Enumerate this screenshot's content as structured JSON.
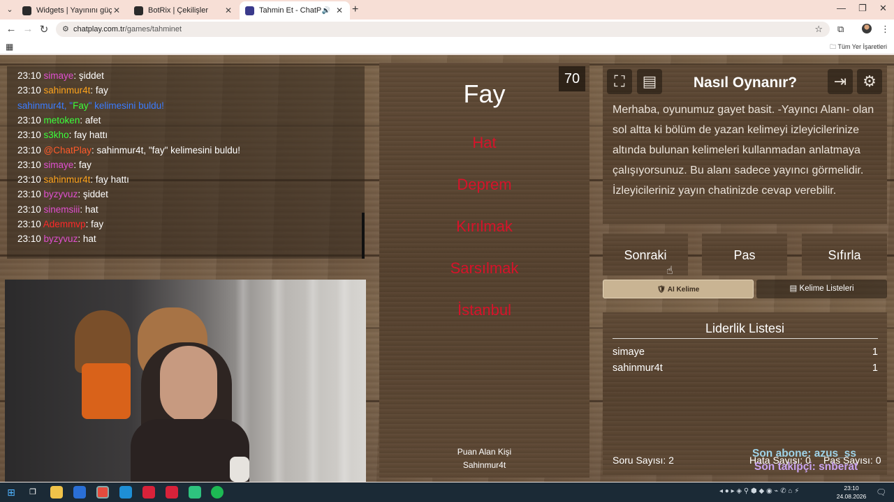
{
  "browser": {
    "tabs": [
      {
        "title": "Widgets | Yayınını güçlendirmek",
        "favicon_color": "#2b2b2b"
      },
      {
        "title": "BotRix | Çekilişler",
        "favicon_color": "#2b2b2b"
      },
      {
        "title": "Tahmin Et - ChatPlay",
        "favicon_color": "#3a3a8c"
      }
    ],
    "url_host": "chatplay.com.tr",
    "url_path": "/games/tahminet",
    "bookmarks_all": "Tüm Yer İşaretleri"
  },
  "chat": {
    "lines": [
      {
        "time": "23:10",
        "user": "simaye",
        "color": "#e04fd0",
        "msg": ": şiddet"
      },
      {
        "time": "23:10",
        "user": "sahinmur4t",
        "color": "#ffa41c",
        "msg": ": fay"
      },
      {
        "time": "",
        "user": "sahinmur4t, \"",
        "color": "#3b7cff",
        "msg": "",
        "special": "found",
        "word": "Fay",
        "rest": "\" kelimesini buldu!"
      },
      {
        "time": "23:10",
        "user": "metoken",
        "color": "#3bff3b",
        "msg": ": afet"
      },
      {
        "time": "23:10",
        "user": "s3kho",
        "color": "#3bff3b",
        "msg": ": fay hattı"
      },
      {
        "time": "23:10",
        "user": "@ChatPlay",
        "color": "#ff5a2a",
        "msg": ": sahinmur4t, \"fay\" kelimesini buldu!"
      },
      {
        "time": "23:10",
        "user": "simaye",
        "color": "#e04fd0",
        "msg": ": fay"
      },
      {
        "time": "23:10",
        "user": "sahinmur4t",
        "color": "#ffa41c",
        "msg": ": fay hattı"
      },
      {
        "time": "23:10",
        "user": "byzyvuz",
        "color": "#e04fd0",
        "msg": ": şiddet"
      },
      {
        "time": "23:10",
        "user": "sinemsiii",
        "color": "#e04fd0",
        "msg": ": hat"
      },
      {
        "time": "23:10",
        "user": "Ademmvp",
        "color": "#ff2a2a",
        "msg": ": fay"
      },
      {
        "time": "23:10",
        "user": "byzyvuz",
        "color": "#e04fd0",
        "msg": ": hat"
      }
    ]
  },
  "card": {
    "score": "70",
    "word": "Fay",
    "taboo": [
      "Hat",
      "Deprem",
      "Kırılmak",
      "Sarsılmak",
      "İstanbul"
    ],
    "scorer_label": "Puan Alan Kişi",
    "scorer_name": "Sahinmur4t"
  },
  "howto": {
    "title": "Nasıl Oynanır?",
    "text": "Merhaba, oyunumuz gayet basit. -Yayıncı Alanı- olan sol altta ki bölüm de yazan kelimeyi izleyicilerinize altında bulunan kelimeleri kullanmadan anlatmaya çalışıyorsunuz. Bu alanı sadece yayıncı görmelidir. İzleyicileriniz yayın chatinizde cevap verebilir."
  },
  "controls": {
    "next": "Sonraki",
    "pass": "Pas",
    "reset": "Sıfırla",
    "ai_word": "🛡 AI Kelime",
    "word_lists": "Kelime Listeleri"
  },
  "leaderboard": {
    "title": "Liderlik Listesi",
    "rows": [
      {
        "name": "simaye",
        "points": "1"
      },
      {
        "name": "sahinmur4t",
        "points": "1"
      }
    ],
    "question_count": "Soru Sayısı: 2",
    "error_count": "Hata Sayısı: 0",
    "pass_count": "Pas Sayısı: 0"
  },
  "stream_overlay": {
    "last_sub": "Son abone: azus_ss",
    "last_follower": "Son takipçi: snberat"
  },
  "taskbar": {
    "time": "23:10",
    "date": "24.08.2026"
  }
}
